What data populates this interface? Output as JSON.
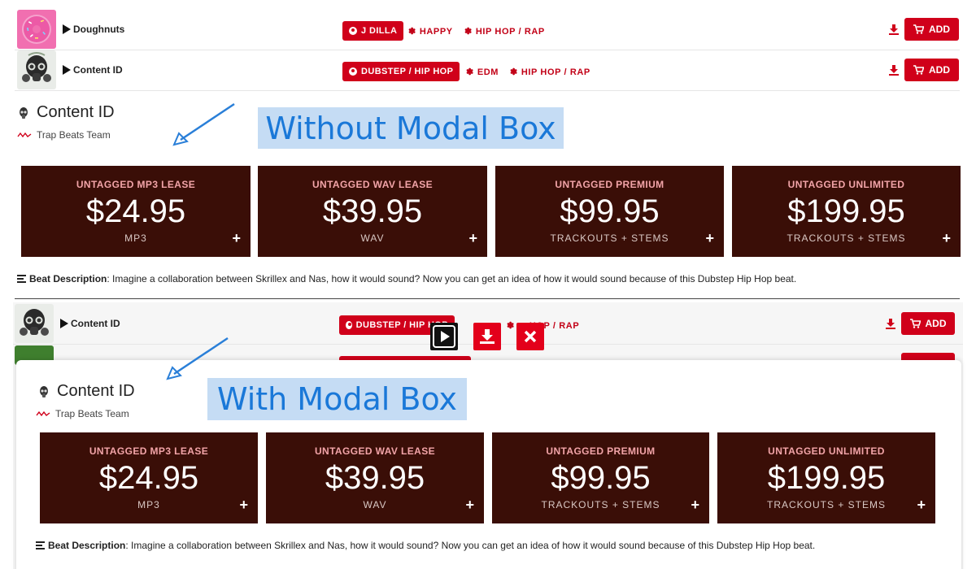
{
  "top_rows": [
    {
      "title": "Doughnuts",
      "thumb_icon": "donut-thumbnail",
      "primary_tag": "J DILLA",
      "tags": [
        "HAPPY",
        "HIP HOP / RAP"
      ],
      "add_label": "ADD"
    },
    {
      "title": "Content ID",
      "thumb_icon": "gasmask-thumbnail",
      "primary_tag": "DUBSTEP / HIP HOP",
      "tags": [
        "EDM",
        "HIP HOP / RAP"
      ],
      "add_label": "ADD"
    }
  ],
  "without_modal": {
    "callout": "Without Modal Box",
    "beat_title": "Content ID",
    "producer": "Trap Beats Team",
    "licenses": [
      {
        "name": "UNTAGGED MP3 LEASE",
        "price": "$24.95",
        "format": "MP3"
      },
      {
        "name": "UNTAGGED WAV LEASE",
        "price": "$39.95",
        "format": "WAV"
      },
      {
        "name": "UNTAGGED PREMIUM",
        "price": "$99.95",
        "format": "TRACKOUTS + STEMS"
      },
      {
        "name": "UNTAGGED UNLIMITED",
        "price": "$199.95",
        "format": "TRACKOUTS + STEMS"
      }
    ],
    "description_label": "Beat Description",
    "description_text": ": Imagine a collaboration between Skrillex and Nas, how it would sound? Now you can get an idea of how it would sound because of this Dubstep Hip Hop beat."
  },
  "background_row": {
    "title": "Content ID",
    "primary_tag": "DUBSTEP / HIP HOP",
    "tag_partial": "HOP / RAP",
    "add_label": "ADD"
  },
  "with_modal": {
    "callout": "With Modal Box",
    "beat_title": "Content ID",
    "producer": "Trap Beats Team",
    "licenses": [
      {
        "name": "UNTAGGED MP3 LEASE",
        "price": "$24.95",
        "format": "MP3"
      },
      {
        "name": "UNTAGGED WAV LEASE",
        "price": "$39.95",
        "format": "WAV"
      },
      {
        "name": "UNTAGGED PREMIUM",
        "price": "$99.95",
        "format": "TRACKOUTS + STEMS"
      },
      {
        "name": "UNTAGGED UNLIMITED",
        "price": "$199.95",
        "format": "TRACKOUTS + STEMS"
      }
    ],
    "description_label": "Beat Description",
    "description_text": ": Imagine a collaboration between Skrillex and Nas, how it would sound? Now you can get an idea of how it would sound because of this Dubstep Hip Hop beat."
  },
  "modal_controls": [
    "play-icon",
    "download-icon",
    "close-icon"
  ],
  "colors": {
    "accent_red": "#d0001a",
    "license_bg": "#3a0e07",
    "callout_bg": "#c5dcf4",
    "callout_text": "#1a78d8"
  }
}
